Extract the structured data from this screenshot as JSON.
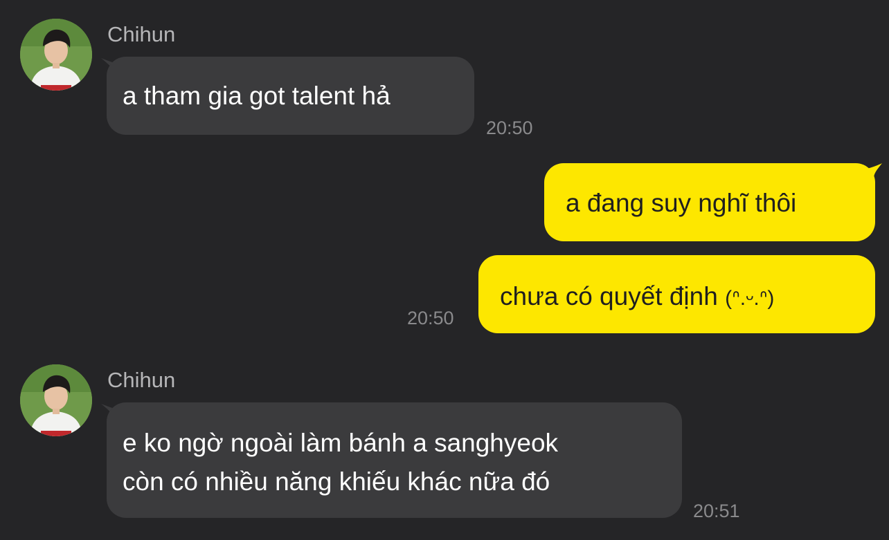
{
  "messages": [
    {
      "direction": "incoming",
      "sender": "Chihun",
      "avatar_icon": "profile-photo-avatar",
      "text": "a tham gia got talent hả",
      "time": "20:50"
    },
    {
      "direction": "outgoing",
      "text": "a đang suy nghĩ thôi"
    },
    {
      "direction": "outgoing",
      "text": "chưa có quyết định",
      "kaomoji": "(ᐢ.ᵕ.ᐢ)",
      "time": "20:50"
    },
    {
      "direction": "incoming",
      "sender": "Chihun",
      "avatar_icon": "profile-photo-avatar",
      "lines": [
        "e ko ngờ ngoài làm bánh a sanghyeok",
        "còn có nhiều năng khiếu khác nữa đó"
      ],
      "time": "20:51"
    }
  ],
  "colors": {
    "background": "#252527",
    "incoming_bubble": "#3b3b3d",
    "outgoing_bubble": "#fde700",
    "sender_name": "#b6b6b8",
    "timestamp": "#8a8a8c"
  }
}
